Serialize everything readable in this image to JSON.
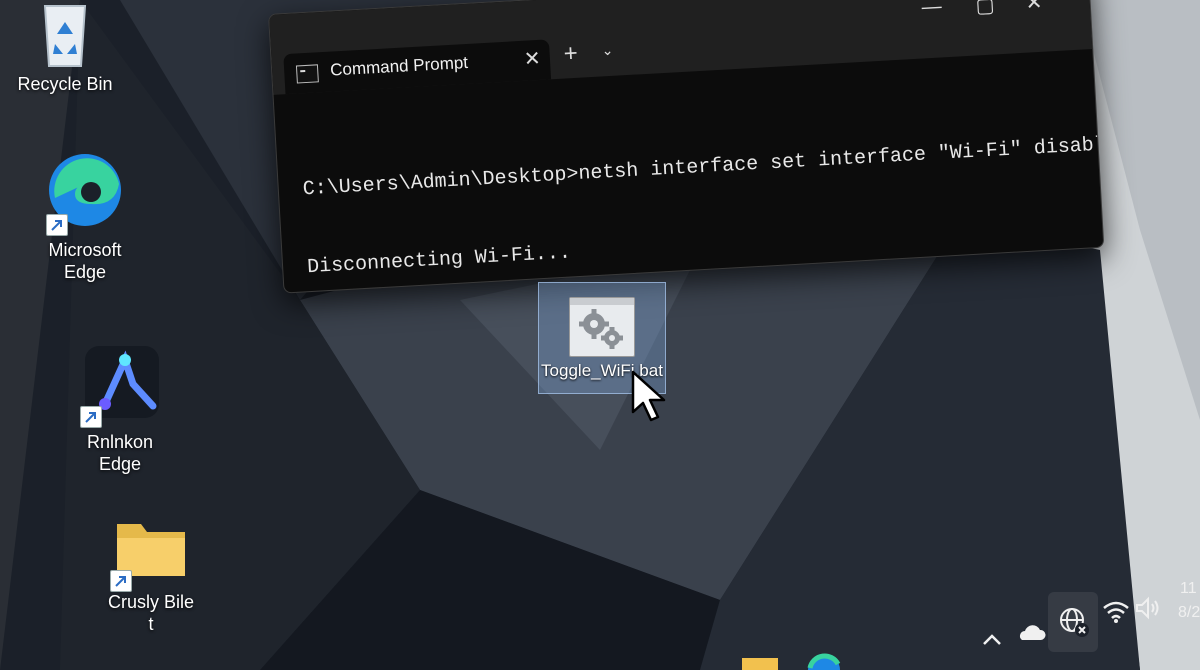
{
  "desktop": {
    "icons": [
      {
        "label": "Recycle Bin"
      },
      {
        "label": "Microsoft Edge"
      },
      {
        "label": "Rnlnkon Edge"
      },
      {
        "label": "Crusly Bile t"
      }
    ],
    "bat_file": {
      "label": "Toggle_WiFi.bat"
    }
  },
  "terminal": {
    "tab_title": "Command Prompt",
    "new_tab_glyph": "+",
    "menu_glyph": "⌄",
    "close_tab_glyph": "✕",
    "minimize_glyph": "—",
    "maximize_glyph": "▢",
    "close_glyph": "✕",
    "lines": [
      "C:\\Users\\Admin\\Desktop>netsh interface set interface \"Wi-Fi\" disable",
      "Disconnecting Wi-Fi..."
    ]
  },
  "taskbar": {
    "clock_time": "11",
    "clock_date": "8/2",
    "tray_icons": [
      "chevron-up-icon",
      "onedrive-cloud-icon",
      "globe-disconnected-icon",
      "wifi-icon",
      "volume-icon"
    ]
  },
  "colors": {
    "accent": "#3a8ee6",
    "terminal_bg": "#0c0c0c",
    "tab_bar": "#202020"
  }
}
